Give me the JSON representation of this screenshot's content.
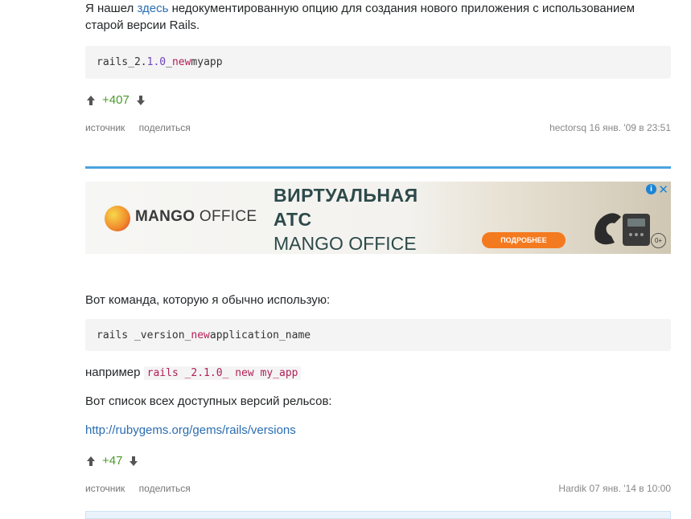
{
  "answer1": {
    "text_before_link": "Я нашел ",
    "link_text": "здесь",
    "text_after_link": " недокументированную опцию для создания нового приложения с использованием старой версии Rails.",
    "code": {
      "cmd": "rails",
      "ver_prefix": " _2.",
      "ver_num": "1.0",
      "ver_suffix": "_ ",
      "kw": "new",
      "arg": " myapp"
    },
    "votes": "+407",
    "source_label": "источник",
    "share_label": "поделиться",
    "author": "hectorsq",
    "date": "16 янв. '09 в 23:51"
  },
  "ad": {
    "brand_bold": "MANGO",
    "brand_light": " OFFICE",
    "headline1": "ВИРТУАЛЬНАЯ",
    "headline2": "АТС",
    "headline3": "MANGO OFFICE",
    "cta": "ПОДРОБНЕЕ",
    "info": "i",
    "close": "✕",
    "age": "0+"
  },
  "answer2": {
    "intro": "Вот команда, которую я обычно использую:",
    "code": {
      "cmd": "rails _version_ ",
      "kw": "new",
      "arg": " application_name"
    },
    "example_label": "например",
    "example_code": "rails _2.1.0_ new my_app",
    "list_text": "Вот список всех доступных версий рельсов:",
    "link": "http://rubygems.org/gems/rails/versions",
    "votes": "+47",
    "source_label": "источник",
    "share_label": "поделиться",
    "author": "Hardik",
    "date": "07 янв. '14 в 10:00"
  },
  "colors": {
    "accent": "#4aa3df",
    "link": "#2a6db1",
    "votes": "#4c9a2a",
    "keyword": "#b21f56",
    "cta": "#f47a20"
  },
  "icons": [
    "upvote-arrow-icon",
    "downvote-arrow-icon",
    "info-icon",
    "close-icon",
    "phone-icon"
  ]
}
